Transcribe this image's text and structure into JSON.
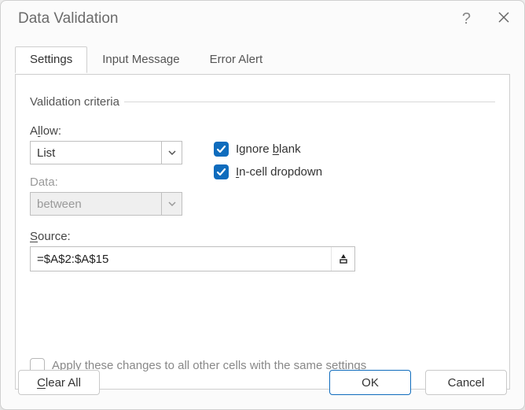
{
  "title": "Data Validation",
  "tabs": {
    "settings": "Settings",
    "input_message": "Input Message",
    "error_alert": "Error Alert"
  },
  "group_label": "Validation criteria",
  "allow": {
    "label_pre": "A",
    "label_u": "l",
    "label_post": "low:",
    "value": "List"
  },
  "data": {
    "label": "Data:",
    "value": "between"
  },
  "ignore_blank": {
    "pre": "Ignore ",
    "u": "b",
    "post": "lank"
  },
  "in_cell": {
    "u": "I",
    "post": "n-cell dropdown"
  },
  "source": {
    "label_u": "S",
    "label_post": "ource:",
    "value": "=$A$2:$A$15"
  },
  "apply_label": "Apply these changes to all other cells with the same settings",
  "buttons": {
    "clear_pre": "",
    "clear_u": "C",
    "clear_post": "lear All",
    "ok": "OK",
    "cancel": "Cancel"
  }
}
